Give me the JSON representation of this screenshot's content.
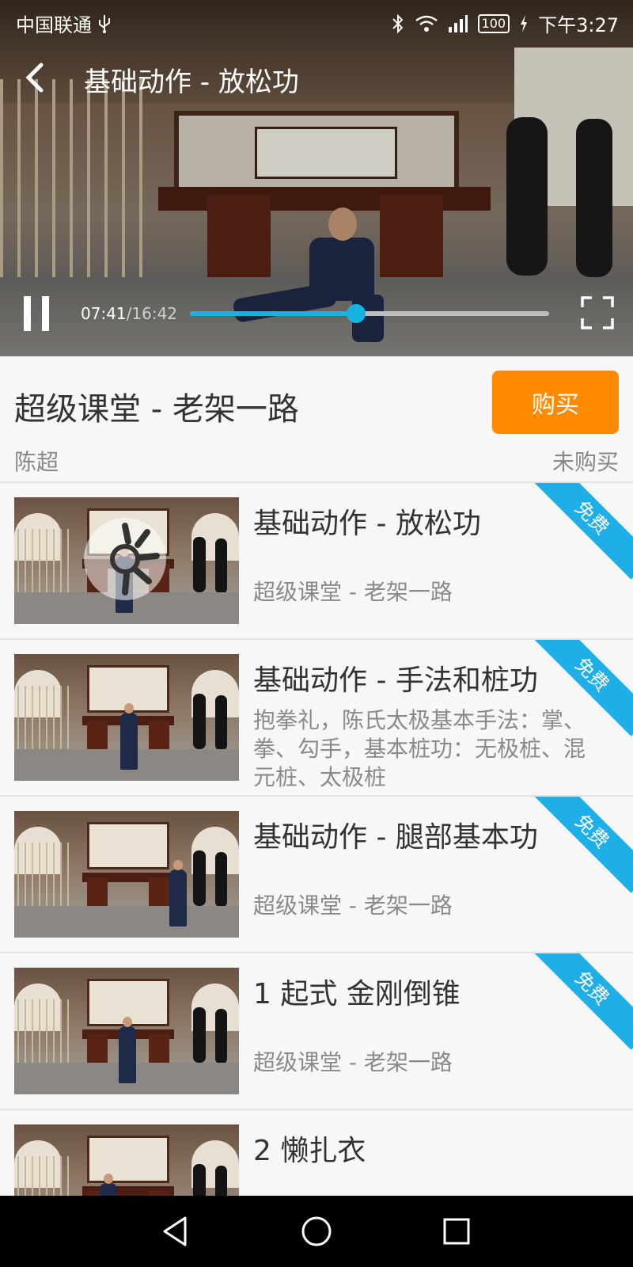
{
  "status_bar": {
    "carrier": "中国联通",
    "usb_icon": "usb-icon",
    "battery": "100",
    "time": "下午3:27"
  },
  "player": {
    "title": "基础动作 - 放松功",
    "current_time": "07:41",
    "total_time": "/16:42",
    "progress_fraction": 0.4626,
    "accent_color": "#17b2e0"
  },
  "course": {
    "title": "超级课堂 - 老架一路",
    "buy_label": "购买",
    "buy_color": "#ff8a00",
    "author": "陈超",
    "purchase_status": "未购买"
  },
  "lessons": [
    {
      "title": "基础动作 - 放松功",
      "subtitle": "超级课堂 - 老架一路",
      "description": "",
      "badge": "免费",
      "playing": true
    },
    {
      "title": "基础动作 - 手法和桩功",
      "subtitle": "",
      "description": "抱拳礼，陈氏太极基本手法：掌、拳、勾手，基本桩功：无极桩、混元桩、太极桩",
      "badge": "免费",
      "playing": false
    },
    {
      "title": "基础动作 - 腿部基本功",
      "subtitle": "超级课堂 - 老架一路",
      "description": "",
      "badge": "免费",
      "playing": false
    },
    {
      "title": "1 起式 金刚倒锥",
      "subtitle": "超级课堂 - 老架一路",
      "description": "",
      "badge": "免费",
      "playing": false
    },
    {
      "title": "2 懒扎衣",
      "subtitle": "",
      "description": "",
      "badge": "",
      "playing": false
    }
  ],
  "badge_color": "#1eaee8"
}
